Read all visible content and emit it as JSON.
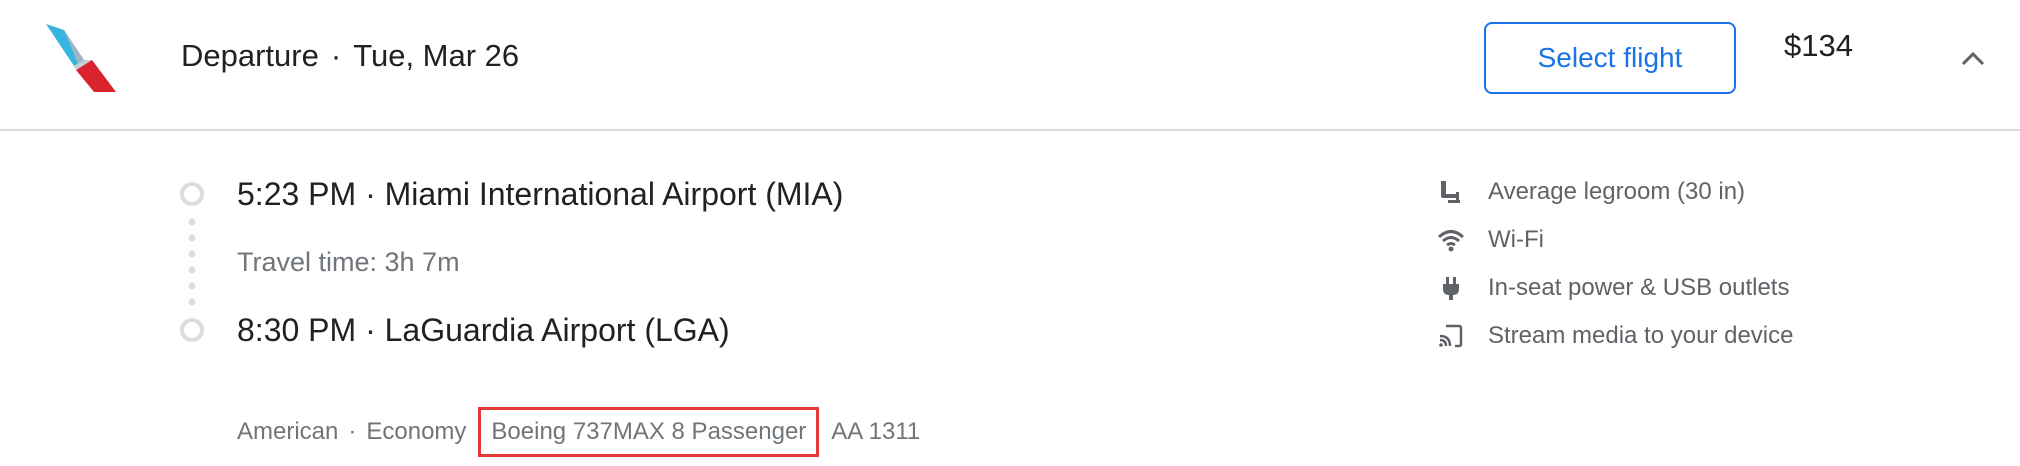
{
  "header": {
    "logo": "american-airlines-logo",
    "title": "Departure",
    "separator": "·",
    "date": "Tue, Mar 26",
    "select_label": "Select flight",
    "price": "$134",
    "collapse_icon": "chevron-up-icon"
  },
  "itinerary": {
    "departure": "5:23 PM · Miami International Airport (MIA)",
    "travel_time": "Travel time: 3h 7m",
    "arrival": "8:30 PM · LaGuardia Airport (LGA)"
  },
  "details": {
    "airline": "American",
    "sep": "·",
    "cabin": "Economy",
    "aircraft": "Boeing 737MAX 8 Passenger",
    "flight_number": "AA 1311"
  },
  "amenities": [
    {
      "icon": "seat-icon",
      "label": "Average legroom (30 in)"
    },
    {
      "icon": "wifi-icon",
      "label": "Wi-Fi"
    },
    {
      "icon": "power-plug-icon",
      "label": "In-seat power & USB outlets"
    },
    {
      "icon": "cast-icon",
      "label": "Stream media to your device"
    }
  ],
  "colors": {
    "accent": "#1a73e8",
    "highlight_box": "#e53935",
    "secondary_text": "#70757a"
  }
}
